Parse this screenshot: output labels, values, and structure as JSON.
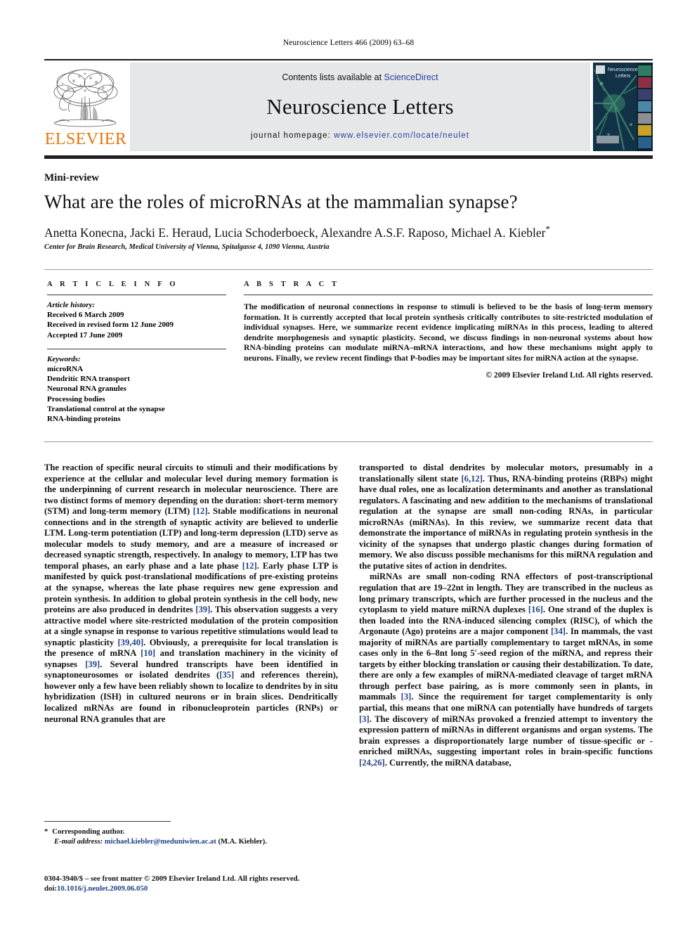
{
  "running_head": "Neuroscience Letters 466 (2009) 63–68",
  "masthead": {
    "publisher_name": "ELSEVIER",
    "contents_prefix": "Contents lists available at ",
    "contents_link": "ScienceDirect",
    "journal_title": "Neuroscience Letters",
    "homepage_prefix": "journal homepage: ",
    "homepage_url": "www.elsevier.com/locate/neulet",
    "cover_title_line1": "Neuroscience",
    "cover_title_line2": "Letters",
    "link_color": "#2a3d9e",
    "elsevier_orange": "#E8750A"
  },
  "article": {
    "doc_type": "Mini-review",
    "title": "What are the roles of microRNAs at the mammalian synapse?",
    "authors": "Anetta Konecna, Jacki E. Heraud, Lucia Schoderboeck, Alexandre A.S.F. Raposo, Michael A. Kiebler",
    "author_marker": "*",
    "affiliation": "Center for Brain Research, Medical University of Vienna, Spitalgasse 4, 1090 Vienna, Austria"
  },
  "article_info": {
    "section_label": "A R T I C L E   I N F O",
    "history_heading": "Article history:",
    "history": [
      "Received 6 March 2009",
      "Received in revised form 12 June 2009",
      "Accepted 17 June 2009"
    ],
    "keywords_heading": "Keywords:",
    "keywords": [
      "microRNA",
      "Dendritic RNA transport",
      "Neuronal RNA granules",
      "Processing bodies",
      "Translational control at the synapse",
      "RNA-binding proteins"
    ]
  },
  "abstract": {
    "section_label": "A B S T R A C T",
    "text": "The modification of neuronal connections in response to stimuli is believed to be the basis of long-term memory formation. It is currently accepted that local protein synthesis critically contributes to site-restricted modulation of individual synapses. Here, we summarize recent evidence implicating miRNAs in this process, leading to altered dendrite morphogenesis and synaptic plasticity. Second, we discuss findings in non-neuronal systems about how RNA-binding proteins can modulate miRNA–mRNA interactions, and how these mechanisms might apply to neurons. Finally, we review recent findings that P-bodies may be important sites for miRNA action at the synapse.",
    "copyright": "© 2009 Elsevier Ireland Ltd. All rights reserved."
  },
  "body": {
    "left_paragraph": "The reaction of specific neural circuits to stimuli and their modifications by experience at the cellular and molecular level during memory formation is the underpinning of current research in molecular neuroscience. There are two distinct forms of memory depending on the duration: short-term memory (STM) and long-term memory (LTM) [12]. Stable modifications in neuronal connections and in the strength of synaptic activity are believed to underlie LTM. Long-term potentiation (LTP) and long-term depression (LTD) serve as molecular models to study memory, and are a measure of increased or decreased synaptic strength, respectively. In analogy to memory, LTP has two temporal phases, an early phase and a late phase [12]. Early phase LTP is manifested by quick post-translational modifications of pre-existing proteins at the synapse, whereas the late phase requires new gene expression and protein synthesis. In addition to global protein synthesis in the cell body, new proteins are also produced in dendrites [39]. This observation suggests a very attractive model where site-restricted modulation of the protein composition at a single synapse in response to various repetitive stimulations would lead to synaptic plasticity [39,40]. Obviously, a prerequisite for local translation is the presence of mRNA [10] and translation machinery in the vicinity of synapses [39]. Several hundred transcripts have been identified in synaptoneurosomes or isolated dendrites ([35] and references therein), however only a few have been reliably shown to localize to dendrites by in situ hybridization (ISH) in cultured neurons or in brain slices. Dendritically localized mRNAs are found in ribonucleoprotein particles (RNPs) or neuronal RNA granules that are",
    "right_paragraph_1": "transported to distal dendrites by molecular motors, presumably in a translationally silent state [6,12]. Thus, RNA-binding proteins (RBPs) might have dual roles, one as localization determinants and another as translational regulators. A fascinating and new addition to the mechanisms of translational regulation at the synapse are small non-coding RNAs, in particular microRNAs (miRNAs). In this review, we summarize recent data that demonstrate the importance of miRNAs in regulating protein synthesis in the vicinity of the synapses that undergo plastic changes during formation of memory. We also discuss possible mechanisms for this miRNA regulation and the putative sites of action in dendrites.",
    "right_paragraph_2": "miRNAs are small non-coding RNA effectors of post-transcriptional regulation that are 19–22nt in length. They are transcribed in the nucleus as long primary transcripts, which are further processed in the nucleus and the cytoplasm to yield mature miRNA duplexes [16]. One strand of the duplex is then loaded into the RNA-induced silencing complex (RISC), of which the Argonaute (Ago) proteins are a major component [34]. In mammals, the vast majority of miRNAs are partially complementary to target mRNAs, in some cases only in the 6–8nt long 5′-seed region of the miRNA, and repress their targets by either blocking translation or causing their destabilization. To date, there are only a few examples of miRNA-mediated cleavage of target mRNA through perfect base pairing, as is more commonly seen in plants, in mammals [3]. Since the requirement for target complementarity is only partial, this means that one miRNA can potentially have hundreds of targets [3]. The discovery of miRNAs provoked a frenzied attempt to inventory the expression pattern of miRNAs in different organisms and organ systems. The brain expresses a disproportionately large number of tissue-specific or -enriched miRNAs, suggesting important roles in brain-specific functions [24,26]. Currently, the miRNA database,"
  },
  "footnote": {
    "marker": "*",
    "corresponding": "Corresponding author.",
    "email_label": "E-mail address:",
    "email": "michael.kiebler@meduniwien.ac.at",
    "email_suffix": "(M.A. Kiebler)."
  },
  "frontmatter": {
    "issn_line": "0304-3940/$ – see front matter © 2009 Elsevier Ireland Ltd. All rights reserved.",
    "doi_label": "doi:",
    "doi_value": "10.1016/j.neulet.2009.06.050"
  }
}
